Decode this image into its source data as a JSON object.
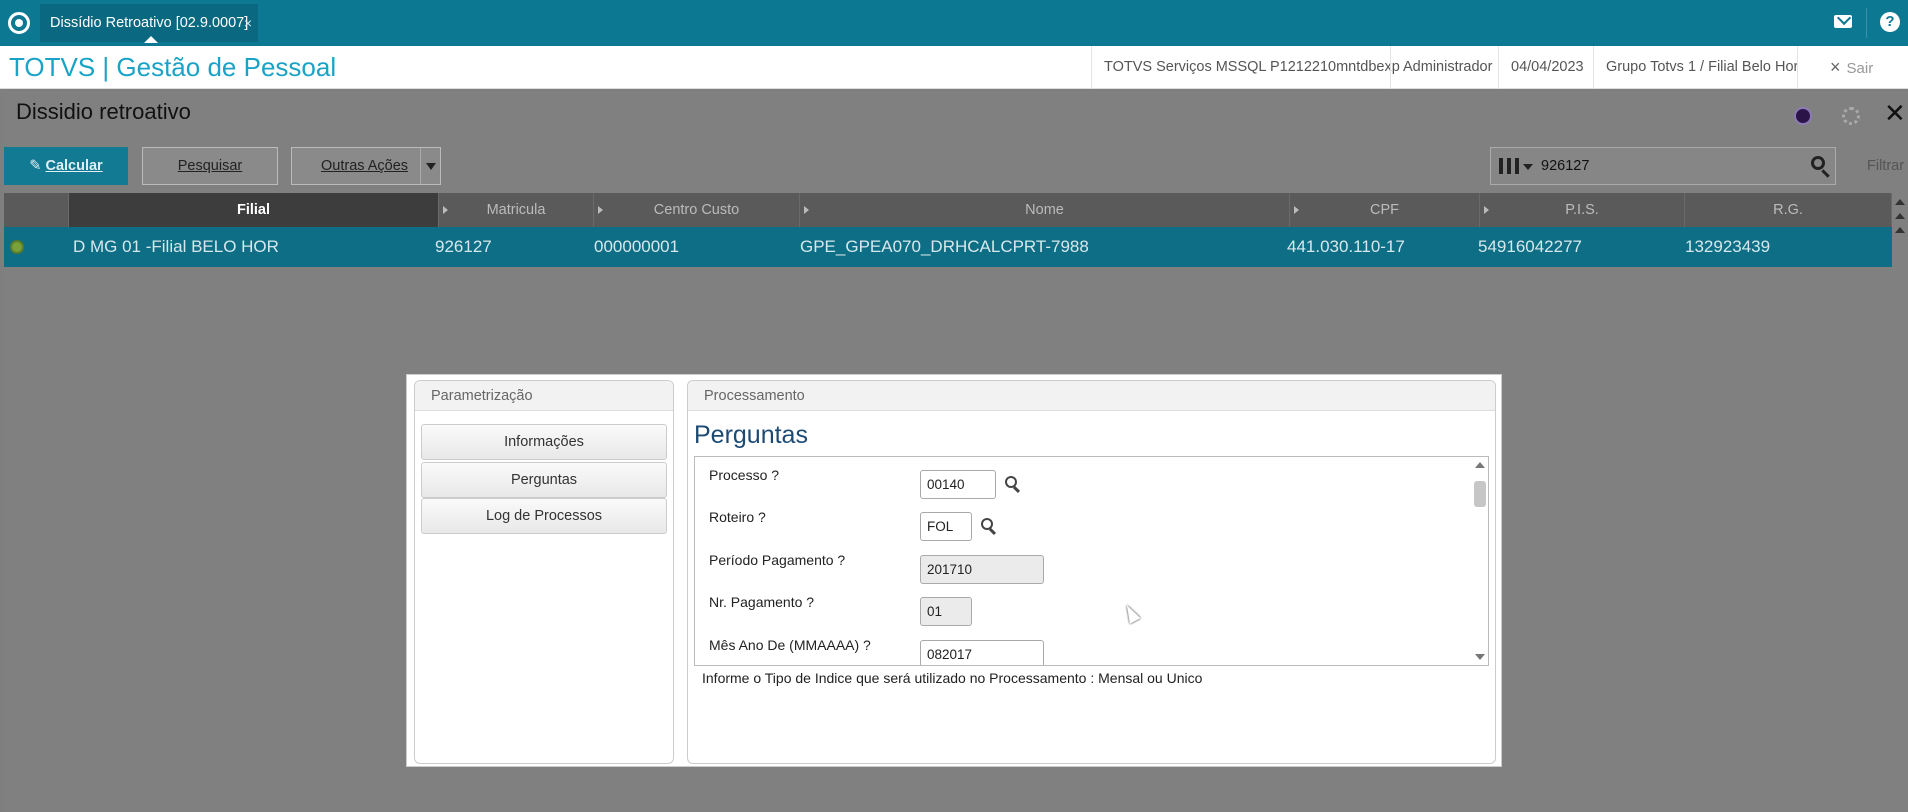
{
  "app": {
    "tab_title": "Dissídio Retroativo [02.9.0007]",
    "tab_close": "×",
    "title": "TOTVS | Gestão de Pessoal",
    "environment": "TOTVS Serviços MSSQL P1212210mntdbexp",
    "user": "Administrador",
    "date": "04/04/2023",
    "company": "Grupo Totvs 1 / Filial Belo Hor",
    "logout": "Sair",
    "logout_icon": "×"
  },
  "window": {
    "title": "Dissidio retroativo",
    "close": "✕"
  },
  "toolbar": {
    "calcular": "Calcular",
    "pesquisar": "Pesquisar",
    "outras_acoes": "Outras Ações",
    "search_value": "926127",
    "filtrar": "Filtrar"
  },
  "grid": {
    "columns": [
      "Filial",
      "Matricula",
      "Centro Custo",
      "Nome",
      "CPF",
      "P.I.S.",
      "R.G."
    ],
    "rows": [
      {
        "filial": "D MG 01 -Filial BELO HOR",
        "matricula": "926127",
        "centro_custo": "000000001",
        "nome": "GPE_GPEA070_DRHCALCPRT-7988",
        "cpf": "441.030.110-17",
        "pis": "54916042277",
        "rg": "132923439"
      }
    ]
  },
  "dialog": {
    "param_title": "Parametrização",
    "nav": [
      "Informações",
      "Perguntas",
      "Log de Processos"
    ],
    "proc_title": "Processamento",
    "section_title": "Perguntas",
    "questions": [
      {
        "label": "Processo ?",
        "value": "00140"
      },
      {
        "label": "Roteiro ?",
        "value": "FOL"
      },
      {
        "label": "Período Pagamento ?",
        "value": "201710"
      },
      {
        "label": "Nr. Pagamento ?",
        "value": "01"
      },
      {
        "label": "Mês Ano De (MMAAAA) ?",
        "value": "082017"
      }
    ],
    "help_text": "Informe o Tipo de Indice que será utilizado no Processamento : Mensal ou Unico"
  },
  "colors": {
    "topbar": "#0c7892",
    "accent": "#1aa3c6",
    "selected_row": "#0e6e85"
  }
}
